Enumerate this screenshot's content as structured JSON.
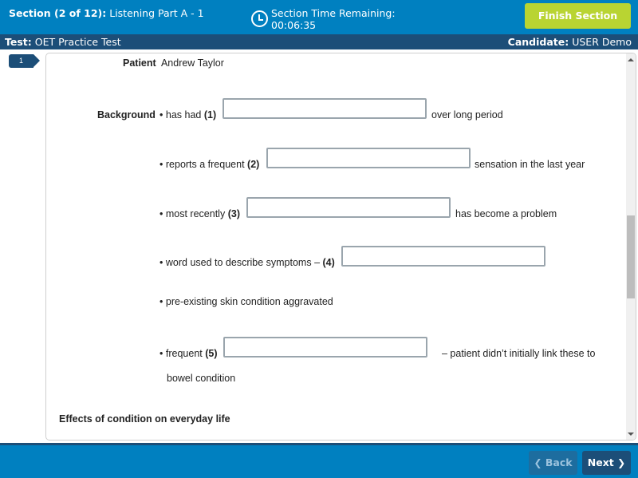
{
  "header": {
    "section_label": "Section (2 of 12):",
    "section_name": "Listening Part A - 1",
    "timer_label": "Section Time Remaining:",
    "timer_value": "00:06:35",
    "timer_icon": "clock-icon",
    "finish_button": "Finish Section"
  },
  "subheader": {
    "test_label": "Test:",
    "test_name": "OET Practice Test",
    "candidate_label": "Candidate:",
    "candidate_name": "USER Demo"
  },
  "question_marker": "1",
  "form": {
    "patient_label": "Patient",
    "patient_name": "Andrew Taylor",
    "background_label": "Background",
    "bullet": "•",
    "items": [
      {
        "before": "has had",
        "num": "(1)",
        "after": "over long period",
        "value": ""
      },
      {
        "before": "reports a frequent",
        "num": "(2)",
        "after": "sensation in the last year",
        "value": ""
      },
      {
        "before": "most recently",
        "num": "(3)",
        "after": "has become a problem",
        "value": ""
      },
      {
        "before": "word used to describe symptoms –",
        "num": "(4)",
        "after": "",
        "value": ""
      },
      {
        "text": "pre-existing skin condition aggravated"
      },
      {
        "before": "frequent",
        "num": "(5)",
        "after": "– patient didn’t initially link these to",
        "after_line2": "bowel condition",
        "value": ""
      }
    ],
    "next_heading": "Effects of condition on everyday life"
  },
  "footer": {
    "back_label": "Back",
    "next_label": "Next",
    "back_icon": "chevron-left-icon",
    "next_icon": "chevron-right-icon"
  },
  "colors": {
    "primary_blue": "#0080c0",
    "dark_blue": "#1c4e78",
    "finish_green": "#b9d432"
  }
}
